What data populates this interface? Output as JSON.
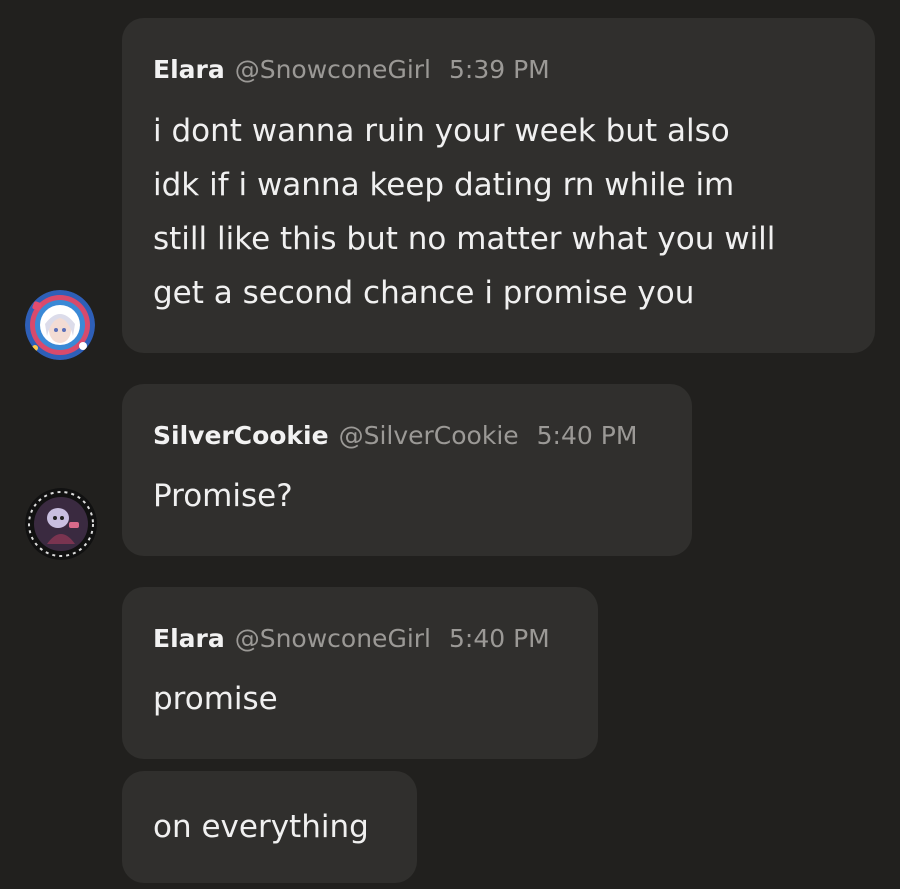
{
  "messages": [
    {
      "author": "Elara",
      "handle": "@SnowconeGirl",
      "time": "5:39 PM",
      "lines": [
        "i dont wanna ruin your week but also",
        "idk if i wanna keep dating rn while im",
        "still like this but no matter what you will",
        "get a second chance i promise you"
      ]
    },
    {
      "author": "SilverCookie",
      "handle": "@SilverCookie",
      "time": "5:40 PM",
      "text": "Promise?"
    },
    {
      "author": "Elara",
      "handle": "@SnowconeGirl",
      "time": "5:40 PM",
      "text": "promise"
    },
    {
      "text": "on everything"
    }
  ],
  "avatars": {
    "elara": "anime-avatar-icon",
    "silvercookie": "character-avatar-icon"
  },
  "colors": {
    "background": "#21201e",
    "bubble": "#302f2d",
    "name": "#f2f2f2",
    "meta": "#9b9996",
    "text": "#f0f0f0"
  }
}
